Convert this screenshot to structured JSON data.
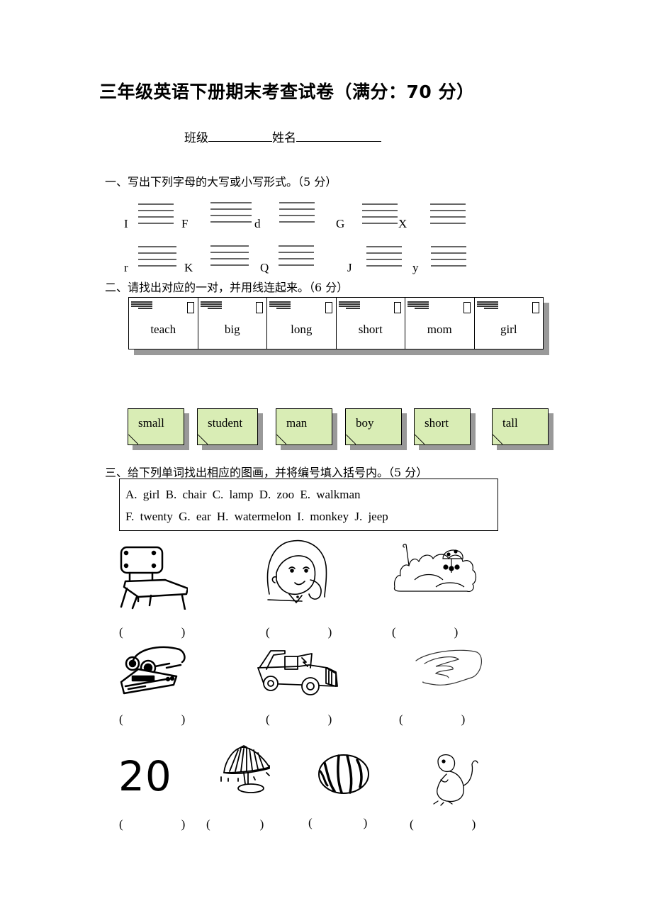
{
  "header": {
    "title": "三年级英语下册期末考查试卷（满分：70 分）",
    "class_label": "班级",
    "name_label": "姓名"
  },
  "section1": {
    "heading": "一、写出下列字母的大写或小写形式。（5 分）",
    "row1": [
      "I",
      "F",
      "d",
      "G",
      "X"
    ],
    "row2": [
      "r",
      "K",
      "Q",
      "J",
      "y"
    ]
  },
  "section2": {
    "heading": "二、请找出对应的一对，并用线连起来。（6 分）",
    "top_words": [
      "teach",
      "big",
      "long",
      "short",
      "mom",
      "girl"
    ],
    "bottom_words": [
      "small",
      "student",
      "man",
      "boy",
      "short",
      "tall"
    ],
    "note_color": "#d9edb5"
  },
  "section3": {
    "heading": "三、给下列单词找出相应的图画，并将编号填入括号内。（5 分）",
    "options_line1": "A. girl    B. chair    C. lamp    D. zoo    E. walkman",
    "options_line2": "F. twenty G. ear   H. watermelon    I. monkey    J. jeep",
    "pictures": [
      {
        "depicts": "chair-icon"
      },
      {
        "depicts": "girl-icon"
      },
      {
        "depicts": "zoo-icon"
      },
      {
        "depicts": "walkman-icon"
      },
      {
        "depicts": "jeep-icon"
      },
      {
        "depicts": "ear-icon"
      },
      {
        "text": "20"
      },
      {
        "depicts": "lamp-icon"
      },
      {
        "depicts": "watermelon-icon"
      },
      {
        "depicts": "monkey-icon"
      }
    ],
    "paren_open": "(",
    "paren_close": ")"
  }
}
